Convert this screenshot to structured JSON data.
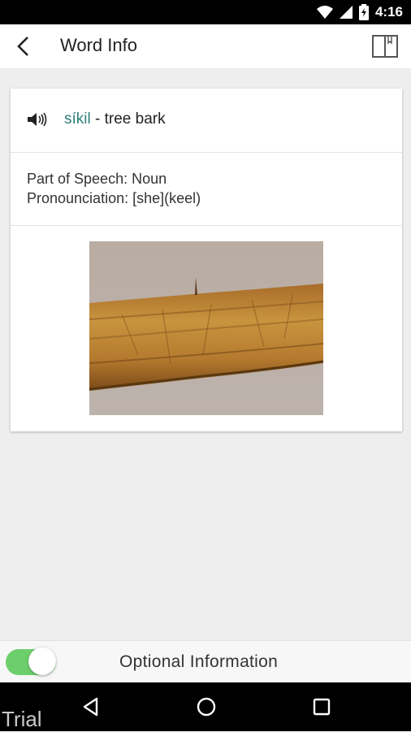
{
  "status_bar": {
    "time": "4:16",
    "icons": [
      "wifi-icon",
      "signal-icon",
      "battery-icon"
    ]
  },
  "app_bar": {
    "title": "Word Info",
    "back_icon": "chevron-left-icon",
    "book_icon": "book-icon"
  },
  "word": {
    "term": "síkil",
    "definition": " - tree bark",
    "speaker_icon": "speaker-icon"
  },
  "details": {
    "part_of_speech": "Part of Speech: Noun",
    "pronunciation": "Pronounciation: [she](keel)"
  },
  "image": {
    "subject": "tree bark photo"
  },
  "optional_bar": {
    "label": "Optional Information",
    "toggle_on": true,
    "accent": "#6ccf6c"
  },
  "nav_bar": {
    "buttons": [
      "back-triangle-icon",
      "home-circle-icon",
      "recents-square-icon"
    ]
  },
  "watermark": "Trial",
  "colors": {
    "term": "#2f7f7a",
    "status_bar": "#000000"
  }
}
